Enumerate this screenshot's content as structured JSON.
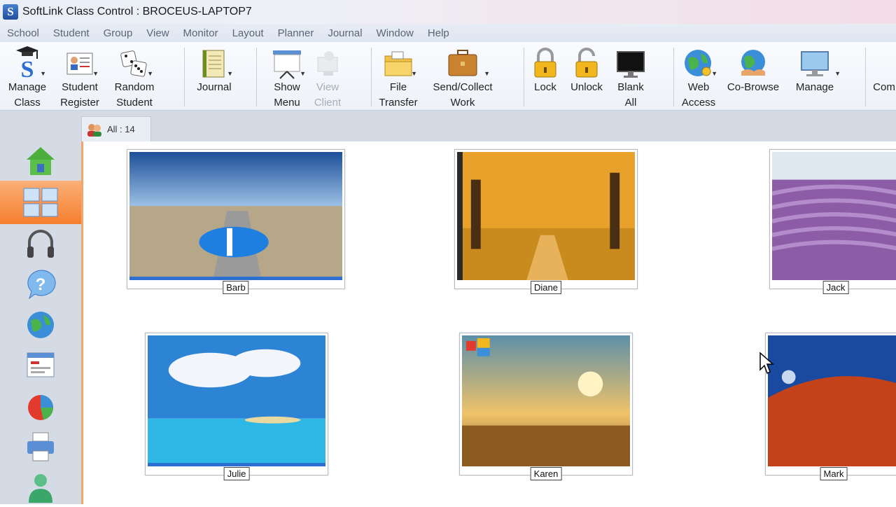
{
  "window": {
    "title": "SoftLink Class Control : BROCEUS-LAPTOP7",
    "app_icon_glyph": "S"
  },
  "menu": [
    "School",
    "Student",
    "Group",
    "View",
    "Monitor",
    "Layout",
    "Planner",
    "Journal",
    "Window",
    "Help"
  ],
  "toolbar": {
    "manage_class": {
      "line1": "Manage",
      "line2": "Class"
    },
    "student_register": {
      "line1": "Student",
      "line2": "Register"
    },
    "random_student": {
      "line1": "Random",
      "line2": "Student"
    },
    "journal": {
      "line1": "Journal"
    },
    "show_menu": {
      "line1": "Show",
      "line2": "Menu"
    },
    "view_client": {
      "line1": "View",
      "line2": "Client"
    },
    "file_transfer": {
      "line1": "File",
      "line2": "Transfer"
    },
    "send_collect": {
      "line1": "Send/Collect",
      "line2": "Work"
    },
    "lock": {
      "line1": "Lock"
    },
    "unlock": {
      "line1": "Unlock"
    },
    "blank_all": {
      "line1": "Blank",
      "line2": "All"
    },
    "web_access": {
      "line1": "Web",
      "line2": "Access"
    },
    "co_browse": {
      "line1": "Co-Browse"
    },
    "manage": {
      "line1": "Manage"
    },
    "partial": {
      "line1": "Com"
    }
  },
  "group_tab": {
    "label": "All : 14"
  },
  "students": [
    {
      "name": "Barb"
    },
    {
      "name": "Diane"
    },
    {
      "name": "Jack"
    },
    {
      "name": "Julie"
    },
    {
      "name": "Karen"
    },
    {
      "name": "Mark"
    }
  ],
  "sidebar_icons": [
    "home-icon",
    "thumbnail-view-icon",
    "headphones-icon",
    "help-icon",
    "globe-icon",
    "window-icon",
    "pie-chart-icon",
    "printer-icon",
    "user-icon"
  ],
  "colors": {
    "accent": "#f57e2d",
    "sidebar": "#d4dbe5"
  }
}
